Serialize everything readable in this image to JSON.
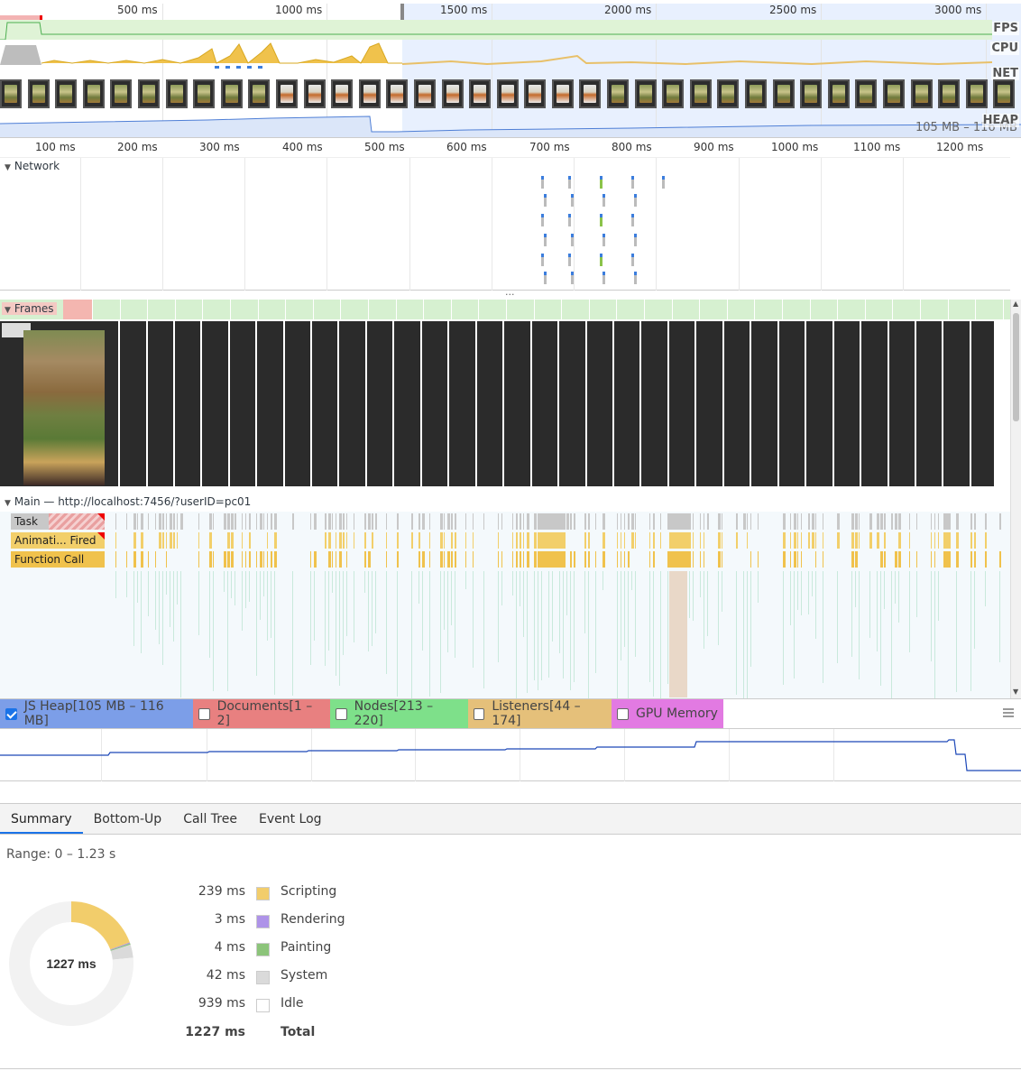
{
  "overview": {
    "ticks": [
      "500 ms",
      "1000 ms",
      "1500 ms",
      "2000 ms",
      "2500 ms",
      "3000 ms"
    ],
    "lanes": {
      "fps": "FPS",
      "cpu": "CPU",
      "net": "NET",
      "heap": "HEAP"
    },
    "heap_range": "105 MB – 116 MB"
  },
  "ruler": {
    "ticks": [
      "100 ms",
      "200 ms",
      "300 ms",
      "400 ms",
      "500 ms",
      "600 ms",
      "700 ms",
      "800 ms",
      "900 ms",
      "1000 ms",
      "1100 ms",
      "1200 ms"
    ]
  },
  "tracks": {
    "network": "Network",
    "frames": "Frames",
    "main": "Main — http://localhost:7456/?userID=pc01"
  },
  "flame": {
    "task": "Task",
    "animation": "Animati... Fired",
    "function_call": "Function Call"
  },
  "counters": [
    {
      "label": "JS Heap[105 MB – 116 MB]",
      "checked": true,
      "color": "#7c9ee8"
    },
    {
      "label": "Documents[1 – 2]",
      "checked": false,
      "color": "#e88080"
    },
    {
      "label": "Nodes[213 – 220]",
      "checked": false,
      "color": "#7ee08a"
    },
    {
      "label": "Listeners[44 – 174]",
      "checked": false,
      "color": "#e5c07a"
    },
    {
      "label": "GPU Memory",
      "checked": false,
      "color": "#e27ae2"
    }
  ],
  "tabs": [
    "Summary",
    "Bottom-Up",
    "Call Tree",
    "Event Log"
  ],
  "summary": {
    "range": "Range: 0 – 1.23 s",
    "center": "1227 ms",
    "rows": [
      {
        "value": "239 ms",
        "name": "Scripting",
        "color": "#f2cd6b",
        "ms": 239
      },
      {
        "value": "3 ms",
        "name": "Rendering",
        "color": "#ae93e8",
        "ms": 3
      },
      {
        "value": "4 ms",
        "name": "Painting",
        "color": "#8cc47a",
        "ms": 4
      },
      {
        "value": "42 ms",
        "name": "System",
        "color": "#dadada",
        "ms": 42
      },
      {
        "value": "939 ms",
        "name": "Idle",
        "color": "#ffffff",
        "ms": 939
      }
    ],
    "total_value": "1227 ms",
    "total_label": "Total"
  }
}
